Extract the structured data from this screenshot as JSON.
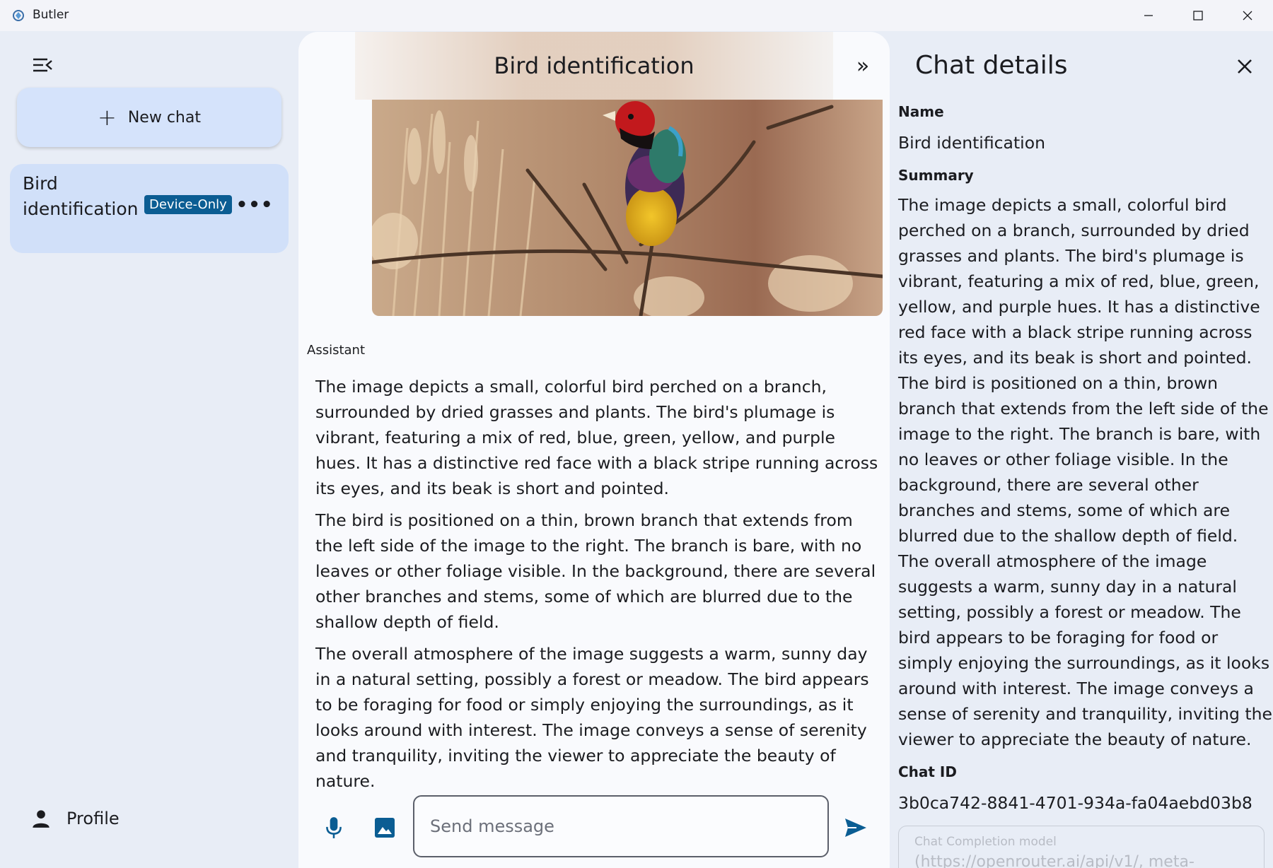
{
  "window": {
    "title": "Butler"
  },
  "sidebar": {
    "new_chat_label": "New chat",
    "chats": [
      {
        "title": "Bird identification",
        "badge": "Device-Only"
      }
    ],
    "profile_label": "Profile"
  },
  "chat": {
    "title": "Bird identification",
    "image_icon": "bird-photo",
    "sender": "Assistant",
    "paragraphs": [
      "The image depicts a small, colorful bird perched on a branch, surrounded by dried grasses and plants. The bird's plumage is vibrant, featuring a mix of red, blue, green, yellow, and purple hues. It has a distinctive red face with a black stripe running across its eyes, and its beak is short and pointed.",
      "The bird is positioned on a thin, brown branch that extends from the left side of the image to the right. The branch is bare, with no leaves or other foliage visible. In the background, there are several other branches and stems, some of which are blurred due to the shallow depth of field.",
      "The overall atmosphere of the image suggests a warm, sunny day in a natural setting, possibly a forest or meadow. The bird appears to be foraging for food or simply enjoying the surroundings, as it looks around with interest. The image conveys a sense of serenity and tranquility, inviting the viewer to appreciate the beauty of nature."
    ],
    "input_placeholder": "Send message"
  },
  "details": {
    "title": "Chat details",
    "name_label": "Name",
    "name_value": "Bird identification",
    "summary_label": "Summary",
    "summary_value": "The image depicts a small, colorful bird perched on a branch, surrounded by dried grasses and plants. The bird's plumage is vibrant, featuring a mix of red, blue, green, yellow, and purple hues. It has a distinctive red face with a black stripe running across its eyes, and its beak is short and pointed. The bird is positioned on a thin, brown branch that extends from the left side of the image to the right. The branch is bare, with no leaves or other foliage visible. In the background, there are several other branches and stems, some of which are blurred due to the shallow depth of field. The overall atmosphere of the image suggests a warm, sunny day in a natural setting, possibly a forest or meadow. The bird appears to be foraging for food or simply enjoying the surroundings, as it looks around with interest. The image conveys a sense of serenity and tranquility, inviting the viewer to appreciate the beauty of nature.",
    "chat_id_label": "Chat ID",
    "chat_id_value": "3b0ca742-8841-4701-934a-fa04aebd03b8",
    "model_label": "Chat Completion model",
    "model_value": "(https://openrouter.ai/api/v1/, meta-"
  },
  "colors": {
    "accent": "#0b5d93",
    "new_chat_bg": "#d5e3fb",
    "selected_chat_bg": "#d1e0f9",
    "panel_bg": "#e8edf6",
    "main_bg": "#f9fafd"
  }
}
